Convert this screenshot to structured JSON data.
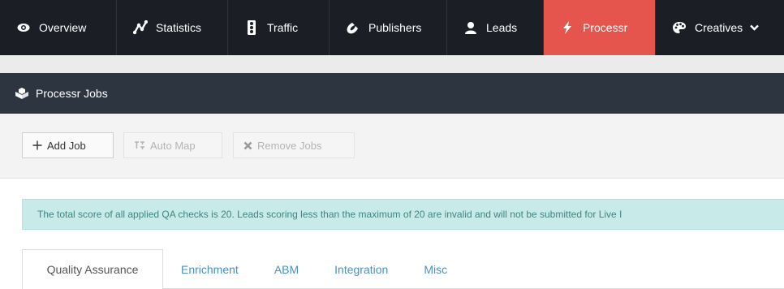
{
  "nav": {
    "items": [
      {
        "label": "Overview",
        "icon": "eye-icon",
        "active": false
      },
      {
        "label": "Statistics",
        "icon": "statistics-icon",
        "active": false
      },
      {
        "label": "Traffic",
        "icon": "traffic-light-icon",
        "active": false
      },
      {
        "label": "Publishers",
        "icon": "magnet-icon",
        "active": false
      },
      {
        "label": "Leads",
        "icon": "user-icon",
        "active": false
      },
      {
        "label": "Processr",
        "icon": "bolt-icon",
        "active": true
      },
      {
        "label": "Creatives",
        "icon": "palette-icon",
        "active": false
      }
    ],
    "active_color": "#e5554d"
  },
  "panel": {
    "title": "Processr Jobs",
    "icon": "cubes-icon"
  },
  "toolbar": {
    "add_label": "Add Job",
    "automap_label": "Auto Map",
    "remove_label": "Remove Jobs"
  },
  "alert": {
    "text": "The total score of all applied QA checks is 20. Leads scoring less than the maximum of 20 are invalid and will not be submitted for Live I"
  },
  "tabs": [
    {
      "label": "Quality Assurance",
      "active": true
    },
    {
      "label": "Enrichment",
      "active": false
    },
    {
      "label": "ABM",
      "active": false
    },
    {
      "label": "Integration",
      "active": false
    },
    {
      "label": "Misc",
      "active": false
    }
  ]
}
